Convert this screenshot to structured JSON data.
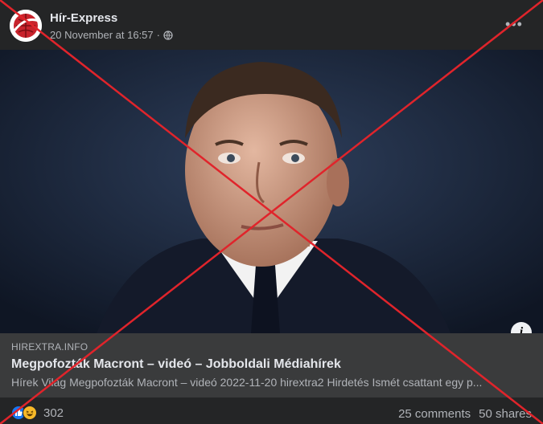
{
  "post": {
    "page_name": "Hír-Express",
    "timestamp": "20 November at 16:57",
    "privacy_icon": "globe-icon",
    "more_icon": "more-horizontal-icon",
    "more_label": "•••"
  },
  "link_preview": {
    "domain": "HIREXTRA.INFO",
    "title": "Megpofozták Macront – videó – Jobboldali Médiahírek",
    "description": "Hírek Világ  Megpofozták Macront – videó 2022-11-20 hirextra2 Hirdetés Ismét csattant egy p...",
    "info_icon": "info-icon",
    "info_label": "i"
  },
  "footer": {
    "reaction_icons": [
      "like-icon",
      "haha-icon"
    ],
    "reaction_count": "302",
    "comments": "25 comments",
    "shares": "50 shares"
  },
  "colors": {
    "background": "#242526",
    "link_panel": "#3a3b3c",
    "cross": "#e0242b",
    "like": "#1877f2",
    "haha": "#f7b928"
  }
}
